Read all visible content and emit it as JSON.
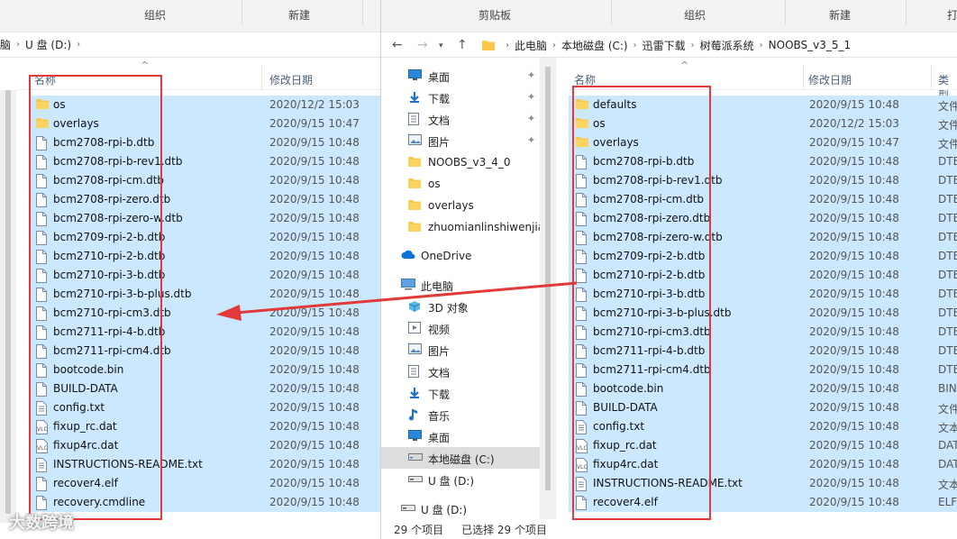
{
  "left_window": {
    "ribbon": {
      "group1": "组织",
      "group2": "新建"
    },
    "breadcrumb": [
      "脑",
      "U 盘 (D:)"
    ],
    "columns": {
      "name": "名称",
      "date": "修改日期"
    },
    "files": [
      {
        "name": "os",
        "date": "2020/12/2 15:03",
        "icon": "folder-icon"
      },
      {
        "name": "overlays",
        "date": "2020/9/15 10:47",
        "icon": "folder-icon"
      },
      {
        "name": "bcm2708-rpi-b.dtb",
        "date": "2020/9/15 10:48",
        "icon": "file-icon"
      },
      {
        "name": "bcm2708-rpi-b-rev1.dtb",
        "date": "2020/9/15 10:48",
        "icon": "file-icon"
      },
      {
        "name": "bcm2708-rpi-cm.dtb",
        "date": "2020/9/15 10:48",
        "icon": "file-icon"
      },
      {
        "name": "bcm2708-rpi-zero.dtb",
        "date": "2020/9/15 10:48",
        "icon": "file-icon"
      },
      {
        "name": "bcm2708-rpi-zero-w.dtb",
        "date": "2020/9/15 10:48",
        "icon": "file-icon"
      },
      {
        "name": "bcm2709-rpi-2-b.dtb",
        "date": "2020/9/15 10:48",
        "icon": "file-icon"
      },
      {
        "name": "bcm2710-rpi-2-b.dtb",
        "date": "2020/9/15 10:48",
        "icon": "file-icon"
      },
      {
        "name": "bcm2710-rpi-3-b.dtb",
        "date": "2020/9/15 10:48",
        "icon": "file-icon"
      },
      {
        "name": "bcm2710-rpi-3-b-plus.dtb",
        "date": "2020/9/15 10:48",
        "icon": "file-icon"
      },
      {
        "name": "bcm2710-rpi-cm3.dtb",
        "date": "2020/9/15 10:48",
        "icon": "file-icon"
      },
      {
        "name": "bcm2711-rpi-4-b.dtb",
        "date": "2020/9/15 10:48",
        "icon": "file-icon"
      },
      {
        "name": "bcm2711-rpi-cm4.dtb",
        "date": "2020/9/15 10:48",
        "icon": "file-icon"
      },
      {
        "name": "bootcode.bin",
        "date": "2020/9/15 10:48",
        "icon": "file-icon"
      },
      {
        "name": "BUILD-DATA",
        "date": "2020/9/15 10:48",
        "icon": "file-icon"
      },
      {
        "name": "config.txt",
        "date": "2020/9/15 10:48",
        "icon": "text-file-icon"
      },
      {
        "name": "fixup_rc.dat",
        "date": "2020/9/15 10:48",
        "icon": "vlc-file-icon"
      },
      {
        "name": "fixup4rc.dat",
        "date": "2020/9/15 10:48",
        "icon": "vlc-file-icon"
      },
      {
        "name": "INSTRUCTIONS-README.txt",
        "date": "2020/9/15 10:48",
        "icon": "text-file-icon"
      },
      {
        "name": "recover4.elf",
        "date": "2020/9/15 10:48",
        "icon": "file-icon"
      },
      {
        "name": "recovery.cmdline",
        "date": "2020/9/15 10:48",
        "icon": "file-icon"
      }
    ]
  },
  "right_window": {
    "ribbon": {
      "group1": "剪贴板",
      "group2": "组织",
      "group3": "新建",
      "group4": "打"
    },
    "breadcrumb": [
      "此电脑",
      "本地磁盘 (C:)",
      "迅雷下载",
      "树莓派系统",
      "NOOBS_v3_5_1"
    ],
    "nav_items": [
      {
        "label": "桌面",
        "icon": "desktop-icon",
        "pinned": true
      },
      {
        "label": "下载",
        "icon": "download-icon",
        "pinned": true
      },
      {
        "label": "文档",
        "icon": "document-icon",
        "pinned": true
      },
      {
        "label": "图片",
        "icon": "picture-icon",
        "pinned": true
      },
      {
        "label": "NOOBS_v3_4_0",
        "icon": "folder-icon",
        "pinned": false
      },
      {
        "label": "os",
        "icon": "folder-icon",
        "pinned": false
      },
      {
        "label": "overlays",
        "icon": "folder-icon",
        "pinned": false
      },
      {
        "label": "zhuomianlinshiwenjia",
        "icon": "folder-icon",
        "pinned": false
      },
      {
        "label": "OneDrive",
        "icon": "cloud-icon",
        "pinned": false
      },
      {
        "label": "此电脑",
        "icon": "computer-icon",
        "pinned": false
      },
      {
        "label": "3D 对象",
        "icon": "cube-icon",
        "pinned": false
      },
      {
        "label": "视频",
        "icon": "video-icon",
        "pinned": false
      },
      {
        "label": "图片",
        "icon": "picture-icon",
        "pinned": false
      },
      {
        "label": "文档",
        "icon": "document-icon",
        "pinned": false
      },
      {
        "label": "下载",
        "icon": "download-icon",
        "pinned": false
      },
      {
        "label": "音乐",
        "icon": "music-icon",
        "pinned": false
      },
      {
        "label": "桌面",
        "icon": "desktop-icon",
        "pinned": false
      },
      {
        "label": "本地磁盘 (C:)",
        "icon": "drive-icon",
        "pinned": false
      },
      {
        "label": "U 盘 (D:)",
        "icon": "usb-drive-icon",
        "pinned": false
      },
      {
        "label": "U 盘 (D:)",
        "icon": "usb-drive-icon",
        "pinned": false
      }
    ],
    "columns": {
      "name": "名称",
      "date": "修改日期",
      "type": "类型"
    },
    "files": [
      {
        "name": "defaults",
        "date": "2020/9/15 10:48",
        "type": "文件",
        "icon": "folder-icon"
      },
      {
        "name": "os",
        "date": "2020/12/2 15:03",
        "type": "文件",
        "icon": "folder-icon"
      },
      {
        "name": "overlays",
        "date": "2020/9/15 10:47",
        "type": "文件",
        "icon": "folder-icon"
      },
      {
        "name": "bcm2708-rpi-b.dtb",
        "date": "2020/9/15 10:48",
        "type": "DTE",
        "icon": "file-icon"
      },
      {
        "name": "bcm2708-rpi-b-rev1.dtb",
        "date": "2020/9/15 10:48",
        "type": "DTE",
        "icon": "file-icon"
      },
      {
        "name": "bcm2708-rpi-cm.dtb",
        "date": "2020/9/15 10:48",
        "type": "DTE",
        "icon": "file-icon"
      },
      {
        "name": "bcm2708-rpi-zero.dtb",
        "date": "2020/9/15 10:48",
        "type": "DTE",
        "icon": "file-icon"
      },
      {
        "name": "bcm2708-rpi-zero-w.dtb",
        "date": "2020/9/15 10:48",
        "type": "DTE",
        "icon": "file-icon"
      },
      {
        "name": "bcm2709-rpi-2-b.dtb",
        "date": "2020/9/15 10:48",
        "type": "DTE",
        "icon": "file-icon"
      },
      {
        "name": "bcm2710-rpi-2-b.dtb",
        "date": "2020/9/15 10:48",
        "type": "DTE",
        "icon": "file-icon"
      },
      {
        "name": "bcm2710-rpi-3-b.dtb",
        "date": "2020/9/15 10:48",
        "type": "DTE",
        "icon": "file-icon"
      },
      {
        "name": "bcm2710-rpi-3-b-plus.dtb",
        "date": "2020/9/15 10:48",
        "type": "DTE",
        "icon": "file-icon"
      },
      {
        "name": "bcm2710-rpi-cm3.dtb",
        "date": "2020/9/15 10:48",
        "type": "DTE",
        "icon": "file-icon"
      },
      {
        "name": "bcm2711-rpi-4-b.dtb",
        "date": "2020/9/15 10:48",
        "type": "DTE",
        "icon": "file-icon"
      },
      {
        "name": "bcm2711-rpi-cm4.dtb",
        "date": "2020/9/15 10:48",
        "type": "DTE",
        "icon": "file-icon"
      },
      {
        "name": "bootcode.bin",
        "date": "2020/9/15 10:48",
        "type": "BIN",
        "icon": "file-icon"
      },
      {
        "name": "BUILD-DATA",
        "date": "2020/9/15 10:48",
        "type": "文件",
        "icon": "file-icon"
      },
      {
        "name": "config.txt",
        "date": "2020/9/15 10:48",
        "type": "文本",
        "icon": "text-file-icon"
      },
      {
        "name": "fixup_rc.dat",
        "date": "2020/9/15 10:48",
        "type": "DAT",
        "icon": "vlc-file-icon"
      },
      {
        "name": "fixup4rc.dat",
        "date": "2020/9/15 10:48",
        "type": "DAT",
        "icon": "vlc-file-icon"
      },
      {
        "name": "INSTRUCTIONS-README.txt",
        "date": "2020/9/15 10:48",
        "type": "文本",
        "icon": "text-file-icon"
      },
      {
        "name": "recover4.elf",
        "date": "2020/9/15 10:48",
        "type": "ELF",
        "icon": "file-icon"
      }
    ],
    "status": {
      "count": "29 个项目",
      "selected": "已选择 29 个项目"
    }
  },
  "watermark": "大数跨境",
  "colors": {
    "selection": "#cce8ff",
    "annotation": "#e23a3a",
    "folder": "#f8c94a",
    "accent": "#0067c0"
  }
}
